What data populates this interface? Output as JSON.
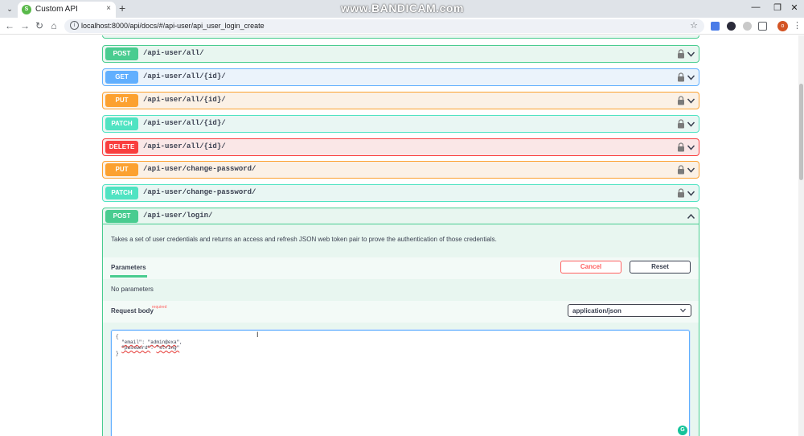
{
  "browser": {
    "tab_title": "Custom API",
    "tab_favicon_glyph": "S",
    "tab_close": "×",
    "new_tab": "+",
    "watermark": "www.BANDICAM.com",
    "url": "localhost:8000/api/docs/#/api-user/api_user_login_create",
    "profile_initial": "o",
    "window_controls": {
      "minimize": "—",
      "restore": "❐",
      "close": "✕"
    },
    "nav": {
      "back": "←",
      "forward": "→",
      "reload": "↻",
      "home": "⌂"
    },
    "star": "☆",
    "kebab": "⋮",
    "tab_menu": "⌄"
  },
  "operations": [
    {
      "method": "POST",
      "path": "/api-user/all/",
      "type": "post"
    },
    {
      "method": "GET",
      "path": "/api-user/all/{id}/",
      "type": "get"
    },
    {
      "method": "PUT",
      "path": "/api-user/all/{id}/",
      "type": "put"
    },
    {
      "method": "PATCH",
      "path": "/api-user/all/{id}/",
      "type": "patch"
    },
    {
      "method": "DELETE",
      "path": "/api-user/all/{id}/",
      "type": "delete"
    },
    {
      "method": "PUT",
      "path": "/api-user/change-password/",
      "type": "put"
    },
    {
      "method": "PATCH",
      "path": "/api-user/change-password/",
      "type": "patch"
    }
  ],
  "expanded_operation": {
    "method": "POST",
    "path": "/api-user/login/",
    "description": "Takes a set of user credentials and returns an access and refresh JSON web token pair to prove the authentication of those credentials.",
    "parameters_tab": "Parameters",
    "cancel_label": "Cancel",
    "reset_label": "Reset",
    "no_parameters": "No parameters",
    "request_body_label": "Request body",
    "required_label": "required",
    "content_type": "application/json",
    "body_lines": {
      "open": "{",
      "email_key": "\"email\"",
      "email_sep": ": ",
      "email_value": "\"admin@exa",
      "email_tail": "\",",
      "password_key": "\"password\"",
      "password_sep": ": ",
      "password_value": "\"string\"",
      "close": "}"
    }
  },
  "colors": {
    "post": "#49cc90",
    "get": "#61affe",
    "put": "#fca130",
    "patch": "#50e3c2",
    "delete": "#f93e3e"
  },
  "icons": {
    "lock": "lock-icon",
    "chevron_down": "chevron-down-icon",
    "chevron_up": "chevron-up-icon"
  }
}
